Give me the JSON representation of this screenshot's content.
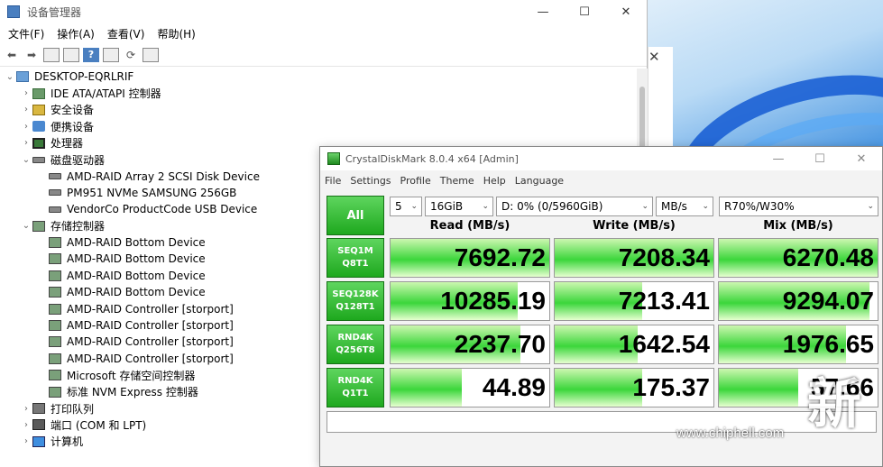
{
  "device_manager": {
    "title": "设备管理器",
    "menu": [
      "文件(F)",
      "操作(A)",
      "查看(V)",
      "帮助(H)"
    ],
    "tree": [
      {
        "level": 0,
        "arrow": "⌄",
        "icon": "computer-icon",
        "cls": "i-pc",
        "label": "DESKTOP-EQRLRIF"
      },
      {
        "level": 1,
        "arrow": "›",
        "icon": "ide-controller-icon",
        "cls": "i-ide",
        "label": "IDE ATA/ATAPI 控制器"
      },
      {
        "level": 1,
        "arrow": "›",
        "icon": "security-device-icon",
        "cls": "i-sec",
        "label": "安全设备"
      },
      {
        "level": 1,
        "arrow": "›",
        "icon": "portable-device-icon",
        "cls": "i-port",
        "label": "便携设备"
      },
      {
        "level": 1,
        "arrow": "›",
        "icon": "processor-icon",
        "cls": "i-cpu",
        "label": "处理器"
      },
      {
        "level": 1,
        "arrow": "⌄",
        "icon": "disk-drive-icon",
        "cls": "i-disk",
        "label": "磁盘驱动器"
      },
      {
        "level": 2,
        "arrow": "",
        "icon": "disk-icon",
        "cls": "i-disk",
        "label": "AMD-RAID Array 2  SCSI Disk Device"
      },
      {
        "level": 2,
        "arrow": "",
        "icon": "disk-icon",
        "cls": "i-disk",
        "label": "PM951 NVMe SAMSUNG 256GB"
      },
      {
        "level": 2,
        "arrow": "",
        "icon": "disk-icon",
        "cls": "i-disk",
        "label": "VendorCo ProductCode USB Device"
      },
      {
        "level": 1,
        "arrow": "⌄",
        "icon": "storage-controller-icon",
        "cls": "i-stor",
        "label": "存储控制器"
      },
      {
        "level": 2,
        "arrow": "",
        "icon": "storage-icon",
        "cls": "i-stor",
        "label": "AMD-RAID Bottom Device"
      },
      {
        "level": 2,
        "arrow": "",
        "icon": "storage-icon",
        "cls": "i-stor",
        "label": "AMD-RAID Bottom Device"
      },
      {
        "level": 2,
        "arrow": "",
        "icon": "storage-icon",
        "cls": "i-stor",
        "label": "AMD-RAID Bottom Device"
      },
      {
        "level": 2,
        "arrow": "",
        "icon": "storage-icon",
        "cls": "i-stor",
        "label": "AMD-RAID Bottom Device"
      },
      {
        "level": 2,
        "arrow": "",
        "icon": "storage-icon",
        "cls": "i-stor",
        "label": "AMD-RAID Controller [storport]"
      },
      {
        "level": 2,
        "arrow": "",
        "icon": "storage-icon",
        "cls": "i-stor",
        "label": "AMD-RAID Controller [storport]"
      },
      {
        "level": 2,
        "arrow": "",
        "icon": "storage-icon",
        "cls": "i-stor",
        "label": "AMD-RAID Controller [storport]"
      },
      {
        "level": 2,
        "arrow": "",
        "icon": "storage-icon",
        "cls": "i-stor",
        "label": "AMD-RAID Controller [storport]"
      },
      {
        "level": 2,
        "arrow": "",
        "icon": "storage-icon",
        "cls": "i-stor",
        "label": "Microsoft 存储空间控制器"
      },
      {
        "level": 2,
        "arrow": "",
        "icon": "storage-icon",
        "cls": "i-stor",
        "label": "标准 NVM Express 控制器"
      },
      {
        "level": 1,
        "arrow": "›",
        "icon": "print-queue-icon",
        "cls": "i-print",
        "label": "打印队列"
      },
      {
        "level": 1,
        "arrow": "›",
        "icon": "port-icon",
        "cls": "i-com",
        "label": "端口 (COM 和 LPT)"
      },
      {
        "level": 1,
        "arrow": "›",
        "icon": "computer-icon",
        "cls": "i-mon",
        "label": "计算机"
      }
    ]
  },
  "cdm": {
    "title": "CrystalDiskMark 8.0.4 x64 [Admin]",
    "menu": [
      "File",
      "Settings",
      "Profile",
      "Theme",
      "Help",
      "Language"
    ],
    "all_label": "All",
    "count": "5",
    "size": "16GiB",
    "drive": "D: 0% (0/5960GiB)",
    "unit": "MB/s",
    "profile": "R70%/W30%",
    "headers": [
      "Read (MB/s)",
      "Write (MB/s)",
      "Mix (MB/s)"
    ],
    "tests": [
      {
        "name": "SEQ1M",
        "sub": "Q8T1",
        "read": "7692.72",
        "write": "7208.34",
        "mix": "6270.48",
        "fill": [
          1.0,
          1.0,
          1.0
        ]
      },
      {
        "name": "SEQ128K",
        "sub": "Q128T1",
        "read": "10285.19",
        "write": "7213.41",
        "mix": "9294.07",
        "fill": [
          0.8,
          0.55,
          0.95
        ]
      },
      {
        "name": "RND4K",
        "sub": "Q256T8",
        "read": "2237.70",
        "write": "1642.54",
        "mix": "1976.65",
        "fill": [
          0.82,
          0.52,
          0.8
        ]
      },
      {
        "name": "RND4K",
        "sub": "Q1T1",
        "read": "44.89",
        "write": "175.37",
        "mix": "57.66",
        "fill": [
          0.45,
          0.55,
          0.5
        ]
      }
    ]
  },
  "watermark": "www.chiphell.com",
  "watermark_logo": "新"
}
